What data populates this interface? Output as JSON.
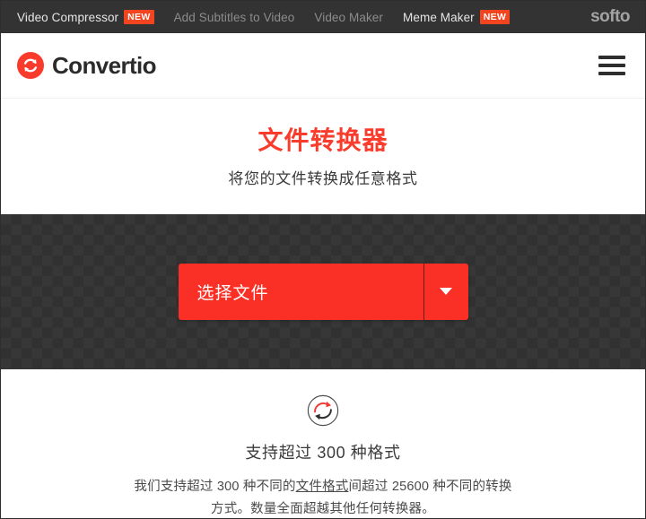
{
  "topbar": {
    "nav": [
      {
        "label": "Video Compressor",
        "badge": "NEW",
        "active": true
      },
      {
        "label": "Add Subtitles to Video",
        "badge": "",
        "active": false
      },
      {
        "label": "Video Maker",
        "badge": "",
        "active": false
      },
      {
        "label": "Meme Maker",
        "badge": "NEW",
        "active": true
      }
    ],
    "brand_right": "softo"
  },
  "header": {
    "brand_name": "Convertio",
    "logo_icon": "convert-circle-arrows-icon",
    "menu_icon": "hamburger-menu-icon"
  },
  "hero": {
    "title": "文件转换器",
    "subtitle": "将您的文件转换成任意格式"
  },
  "dropzone": {
    "choose_file_label": "选择文件",
    "dropdown_icon": "chevron-down-icon"
  },
  "info": {
    "icon": "refresh-convert-icon",
    "heading": "支持超过 300 种格式",
    "body_part1": "我们支持超过 300 种不同的",
    "body_link": "文件格式",
    "body_part2": "间超过 25600 种不同的转换方式。数量全面超越其他任何转换器。"
  },
  "colors": {
    "brand_red": "#fa3c2c",
    "button_red": "#fa2f26",
    "badge_orange": "#f2451f",
    "topbar_dark": "#333333",
    "dropzone_dark": "#373737"
  }
}
